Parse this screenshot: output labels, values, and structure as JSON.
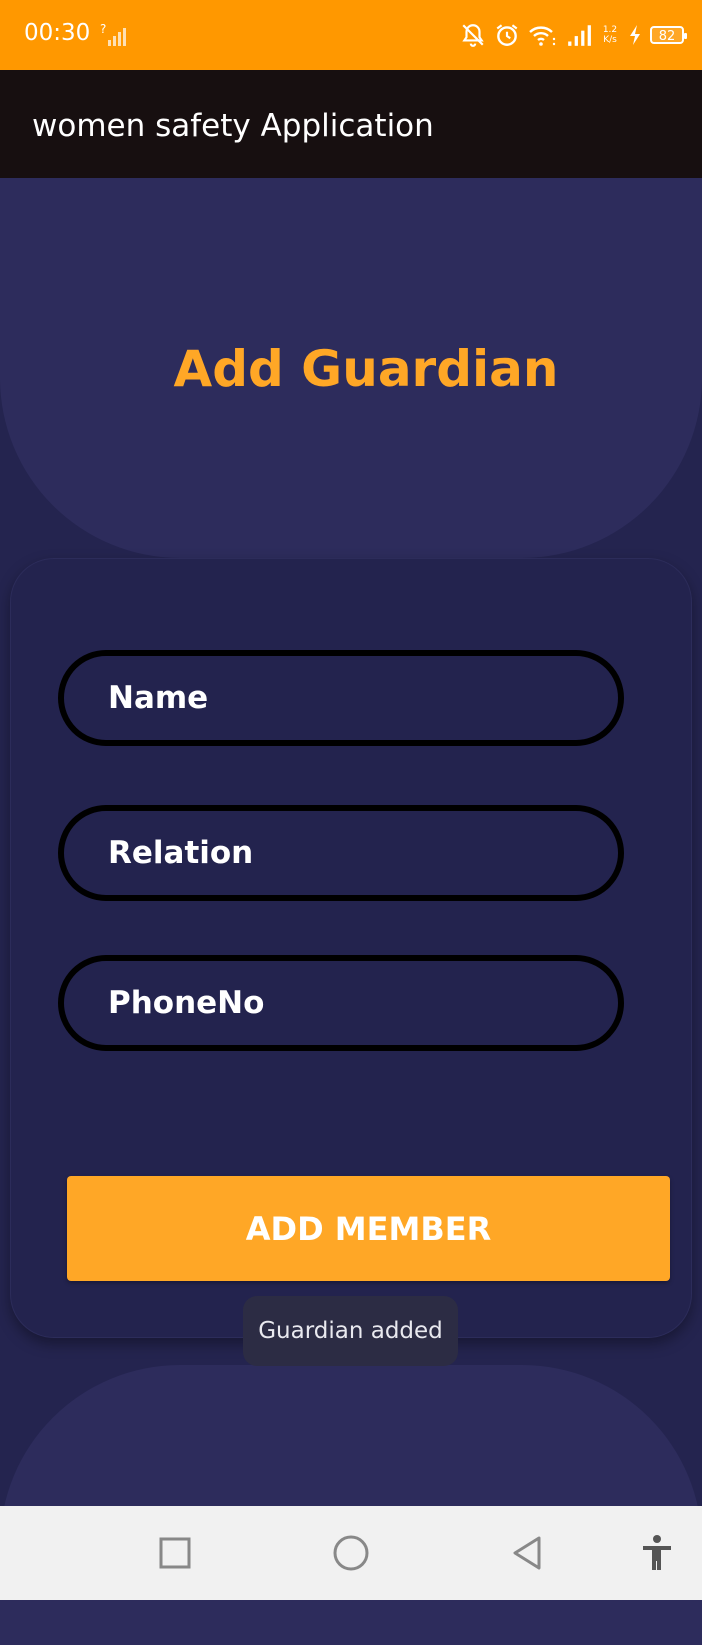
{
  "status_bar": {
    "time": "00:30",
    "net_speed_value": "1.2",
    "net_speed_unit": "K/s",
    "battery_level": "82",
    "accent_color": "#ff9800"
  },
  "app_bar": {
    "title": "women safety Application"
  },
  "page": {
    "title": "Add Guardian",
    "title_color": "#ffa726"
  },
  "form": {
    "name_placeholder": "Name",
    "name_value": "",
    "relation_placeholder": "Relation",
    "relation_value": "",
    "phone_placeholder": "PhoneNo",
    "phone_value": "",
    "submit_label": "ADD MEMBER",
    "button_color": "#ffa726"
  },
  "toast": {
    "message": "Guardian added"
  },
  "nav_bar": {
    "icons": [
      "recents-icon",
      "home-icon",
      "back-icon",
      "accessibility-icon"
    ]
  }
}
